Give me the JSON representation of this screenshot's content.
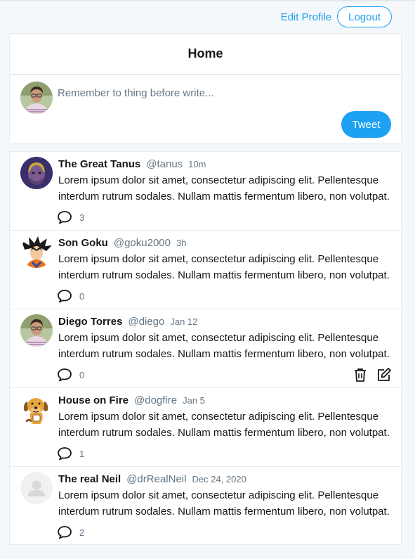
{
  "topbar": {
    "edit_profile": "Edit Profile",
    "logout": "Logout"
  },
  "header": {
    "title": "Home"
  },
  "compose": {
    "placeholder": "Remember to thing before write...",
    "tweet_button": "Tweet"
  },
  "colors": {
    "accent": "#1da1f2",
    "muted": "#657786",
    "text": "#14171a",
    "border": "#e6ecf0"
  },
  "tweets": [
    {
      "name": "The Great Tanus",
      "handle": "@tanus",
      "time": "10m",
      "body": "Lorem ipsum dolor sit amet, consectetur adipiscing elit. Pellentesque interdum rutrum sodales. Nullam mattis fermentum libero, non volutpat.",
      "comments": "3",
      "avatar": "thanos-avatar",
      "own": false
    },
    {
      "name": "Son Goku",
      "handle": "@goku2000",
      "time": "3h",
      "body": "Lorem ipsum dolor sit amet, consectetur adipiscing elit. Pellentesque interdum rutrum sodales. Nullam mattis fermentum libero, non volutpat.",
      "comments": "0",
      "avatar": "goku-avatar",
      "own": false
    },
    {
      "name": "Diego Torres",
      "handle": "@diego",
      "time": "Jan 12",
      "body": "Lorem ipsum dolor sit amet, consectetur adipiscing elit. Pellentesque interdum rutrum sodales. Nullam mattis fermentum libero, non volutpat.",
      "comments": "0",
      "avatar": "user-photo-avatar",
      "own": true
    },
    {
      "name": "House on Fire",
      "handle": "@dogfire",
      "time": "Jan 5",
      "body": "Lorem ipsum dolor sit amet, consectetur adipiscing elit. Pellentesque interdum rutrum sodales. Nullam mattis fermentum libero, non volutpat.",
      "comments": "1",
      "avatar": "dog-avatar",
      "own": false
    },
    {
      "name": "The real Neil",
      "handle": "@drRealNeil",
      "time": "Dec 24, 2020",
      "body": "Lorem ipsum dolor sit amet, consectetur adipiscing elit. Pellentesque interdum rutrum sodales. Nullam mattis fermentum libero, non volutpat.",
      "comments": "2",
      "avatar": "default-user-avatar",
      "own": false
    }
  ]
}
